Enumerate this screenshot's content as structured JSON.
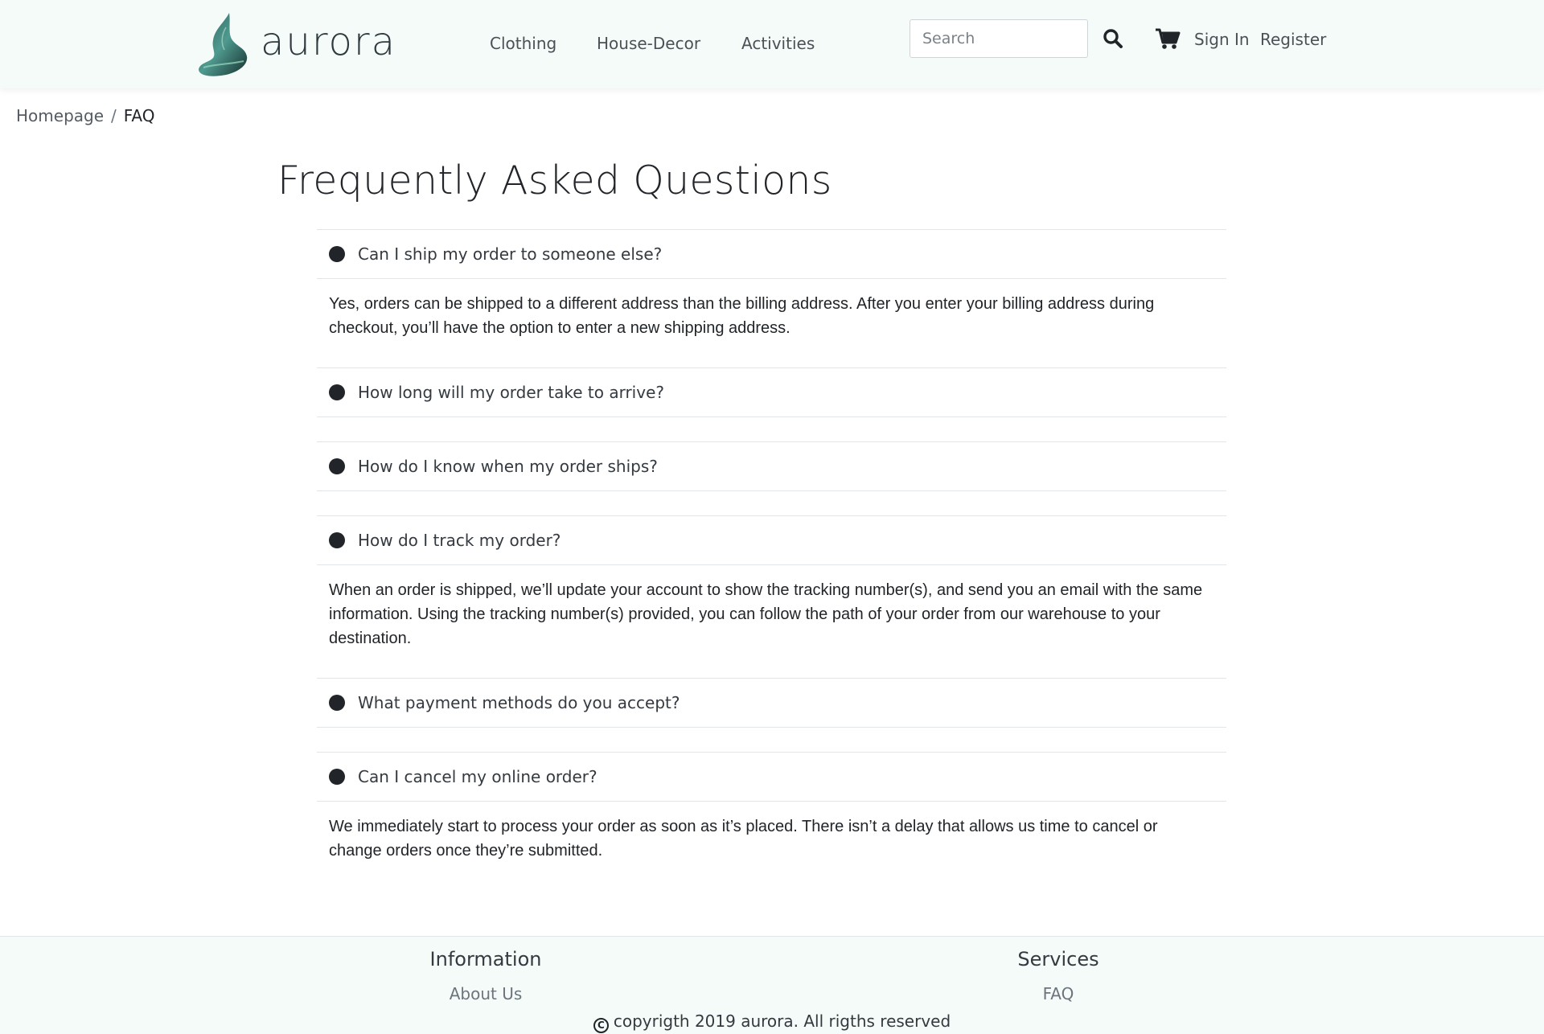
{
  "header": {
    "brand": "aurora",
    "nav": [
      "Clothing",
      "House-Decor",
      "Activities"
    ],
    "search_placeholder": "Search",
    "sign_in": "Sign In",
    "register": "Register"
  },
  "breadcrumb": {
    "home": "Homepage",
    "separator": "/",
    "current": "FAQ"
  },
  "page": {
    "title": "Frequently Asked Questions"
  },
  "faq": [
    {
      "question": "Can I ship my order to someone else?",
      "answer": "Yes, orders can be shipped to a different address than the billing address. After you enter your billing address during checkout, you’ll have the option to enter a new shipping address."
    },
    {
      "question": "How long will my order take to arrive?",
      "answer": ""
    },
    {
      "question": "How do I know when my order ships?",
      "answer": ""
    },
    {
      "question": "How do I track my order?",
      "answer": "When an order is shipped, we’ll update your account to show the tracking number(s), and send you an email with the same information. Using the tracking number(s) provided, you can follow the path of your order from our warehouse to your destination."
    },
    {
      "question": "What payment methods do you accept?",
      "answer": ""
    },
    {
      "question": "Can I cancel my online order?",
      "answer": "We immediately start to process your order as soon as it’s placed. There isn’t a delay that allows us time to cancel or change orders once they’re submitted."
    }
  ],
  "footer": {
    "information_heading": "Information",
    "about_link": "About Us",
    "services_heading": "Services",
    "faq_link": "FAQ",
    "copyright_symbol": "C",
    "copyright": "copyrigth 2019 aurora. All rigths reserved"
  },
  "colors": {
    "header_bg": "#f5fbf8",
    "text_dark": "#212529",
    "nav_text": "#4a5157",
    "divider": "#e3e6e8",
    "logo_teal": "#3f7a73",
    "logo_dark": "#1f3d3a"
  }
}
